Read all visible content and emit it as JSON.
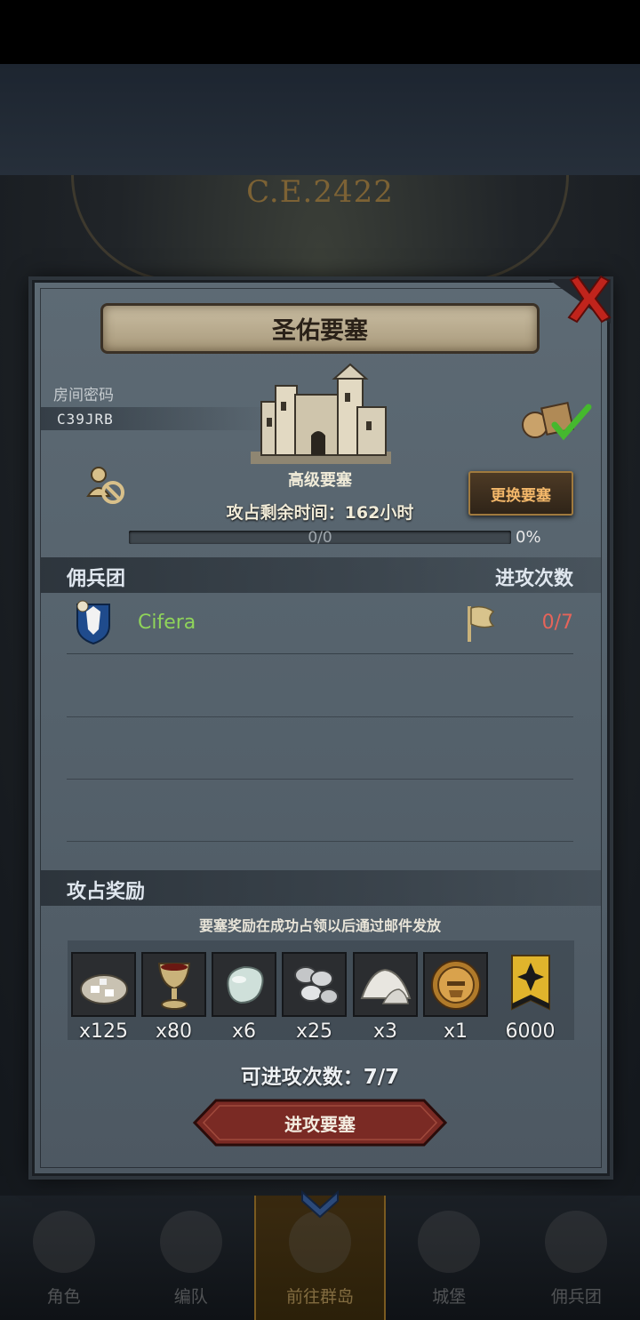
{
  "background": {
    "year": "C.E.2422"
  },
  "dialog": {
    "title": "圣佑要塞",
    "room_label": "房间密码",
    "room_code": "C39JRB",
    "fortress_type": "高级要塞",
    "timer_text": "攻占剩余时间：162小时",
    "progress": {
      "label": "0/0",
      "percent_text": "0%",
      "value": 0
    },
    "change_button": "更换要塞",
    "mercenary_header": "佣兵团",
    "attacks_header": "进攻次数",
    "members": [
      {
        "name": "Cifera",
        "attacks": "0/7"
      }
    ],
    "rewards_header": "攻占奖励",
    "rewards_note": "要塞奖励在成功占领以后通过邮件发放",
    "rewards": [
      {
        "icon": "silver-ore-icon",
        "qty": "x125"
      },
      {
        "icon": "goblet-icon",
        "qty": "x80"
      },
      {
        "icon": "gem-stone-icon",
        "qty": "x6"
      },
      {
        "icon": "silver-ingots-icon",
        "qty": "x25"
      },
      {
        "icon": "powder-pile-icon",
        "qty": "x3"
      },
      {
        "icon": "knight-helmet-icon",
        "qty": "x1"
      },
      {
        "icon": "guild-banner-icon",
        "qty": "6000"
      }
    ],
    "attempts_text": "可进攻次数：7/7",
    "attack_button": "进攻要塞"
  },
  "bottom_nav": [
    {
      "label": "角色",
      "active": false
    },
    {
      "label": "编队",
      "active": false
    },
    {
      "label": "前往群岛",
      "active": true
    },
    {
      "label": "城堡",
      "active": false
    },
    {
      "label": "佣兵团",
      "active": false
    }
  ],
  "colors": {
    "accent_gold": "#c8a24a",
    "member_name": "#8fd45a",
    "attack_count": "#e6645a",
    "change_button_text": "#f4b86a",
    "attack_button": "#7a2a24"
  }
}
